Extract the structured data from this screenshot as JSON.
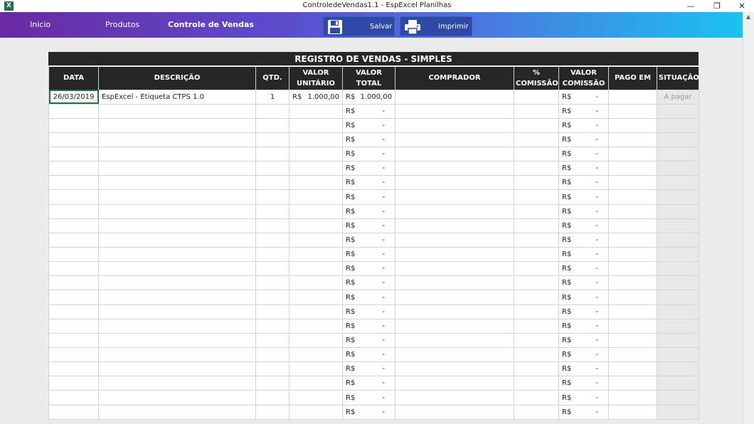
{
  "window": {
    "title": "ControledeVendas1.1 - EspExcel Planilhas",
    "app_icon": "excel-icon",
    "app_icon_letter": "X",
    "minimize": "—",
    "maximize": "❐",
    "close": "✕"
  },
  "ribbon": {
    "nav": [
      "Inicio",
      "Produtos",
      "Controle de Vendas"
    ],
    "buttons": {
      "save_label": "Salvar",
      "print_label": "Imprimir"
    },
    "colors": {
      "gradient_start": "#6a2aa3",
      "gradient_end": "#19c3f0"
    }
  },
  "sheet": {
    "title": "REGISTRO DE VENDAS - SIMPLES",
    "headers": {
      "data": "DATA",
      "descricao": "DESCRIÇÃO",
      "qtd": "QTD.",
      "valor_unitario_1": "VALOR",
      "valor_unitario_2": "UNITÁRIO",
      "valor_total": "VALOR TOTAL",
      "comprador": "COMPRADOR",
      "comissao_pct_1": "%",
      "comissao_pct_2": "COMISSÃO",
      "valor_comissao_1": "VALOR",
      "valor_comissao_2": "COMISSÃO",
      "pago_em": "PAGO EM",
      "situacao": "SITUAÇÃO"
    },
    "currency": "R$",
    "empty_value": "-",
    "first_row": {
      "data": "26/03/2019",
      "descricao": "EspExcel - Etiqueta CTPS 1.0",
      "qtd": "1",
      "valor_unitario": "1.000,00",
      "valor_total": "1.000,00",
      "comprador": "",
      "comissao_pct": "",
      "valor_comissao": "-",
      "pago_em": "",
      "situacao": "A pagar"
    },
    "empty_row_count": 22
  }
}
